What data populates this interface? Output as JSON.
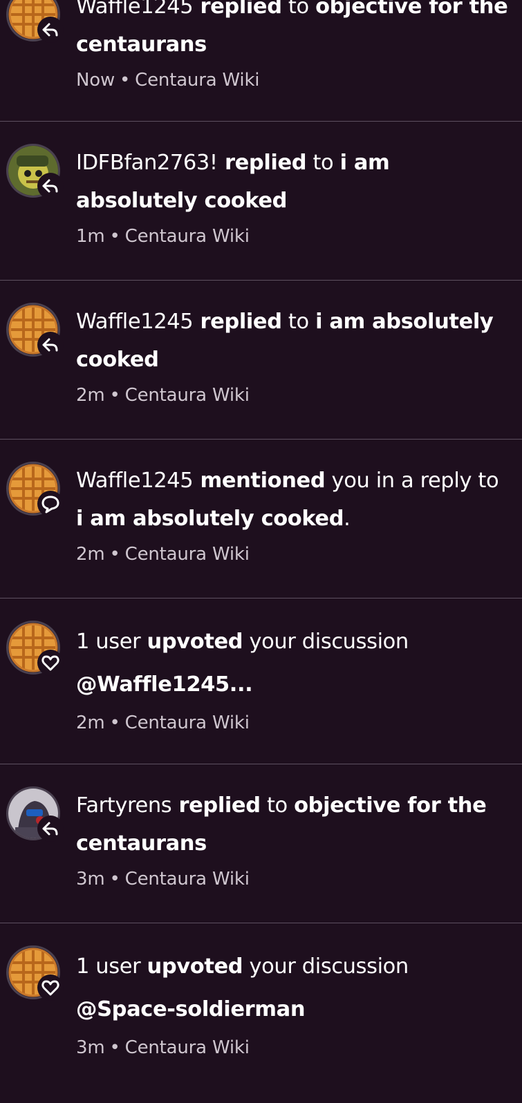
{
  "notifications": [
    {
      "avatar": "waffle-avatar",
      "badge": "reply-icon",
      "parts": [
        {
          "text": "Waffle1245",
          "bold": false
        },
        {
          "text": " replied",
          "bold": true
        },
        {
          "text": " to ",
          "bold": false
        },
        {
          "text": "objective for the centaurans",
          "bold": true
        }
      ],
      "time": "Now",
      "source": "Centaura Wiki"
    },
    {
      "avatar": "idf-avatar",
      "badge": "reply-icon",
      "parts": [
        {
          "text": "IDFBfan2763!",
          "bold": false
        },
        {
          "text": " replied",
          "bold": true
        },
        {
          "text": " to ",
          "bold": false
        },
        {
          "text": "i am absolutely cooked",
          "bold": true
        }
      ],
      "time": "1m",
      "source": "Centaura Wiki"
    },
    {
      "avatar": "waffle-avatar",
      "badge": "reply-icon",
      "parts": [
        {
          "text": "Waffle1245",
          "bold": false
        },
        {
          "text": " replied",
          "bold": true
        },
        {
          "text": " to ",
          "bold": false
        },
        {
          "text": "i am absolutely cooked",
          "bold": true
        }
      ],
      "time": "2m",
      "source": "Centaura Wiki"
    },
    {
      "avatar": "waffle-avatar",
      "badge": "mention-icon",
      "parts": [
        {
          "text": "Waffle1245",
          "bold": false
        },
        {
          "text": " mentioned",
          "bold": true
        },
        {
          "text": " you in a reply to ",
          "bold": false
        },
        {
          "text": "i am absolutely cooked",
          "bold": true
        },
        {
          "text": ".",
          "bold": false
        }
      ],
      "time": "2m",
      "source": "Centaura Wiki"
    },
    {
      "avatar": "waffle-avatar",
      "badge": "heart-icon",
      "parts": [
        {
          "text": "1 user ",
          "bold": false
        },
        {
          "text": "upvoted",
          "bold": true
        },
        {
          "text": " your discussion ",
          "bold": false
        },
        {
          "text": "@Waffle1245...",
          "bold": true
        }
      ],
      "time": "2m",
      "source": "Centaura Wiki"
    },
    {
      "avatar": "fartyrens-avatar",
      "badge": "reply-icon",
      "parts": [
        {
          "text": "Fartyrens",
          "bold": false
        },
        {
          "text": " replied",
          "bold": true
        },
        {
          "text": " to ",
          "bold": false
        },
        {
          "text": "objective for the centaurans",
          "bold": true
        }
      ],
      "time": "3m",
      "source": "Centaura Wiki"
    },
    {
      "avatar": "waffle-avatar",
      "badge": "heart-icon",
      "parts": [
        {
          "text": "1 user ",
          "bold": false
        },
        {
          "text": "upvoted",
          "bold": true
        },
        {
          "text": " your discussion ",
          "bold": false
        },
        {
          "text": "@Space-soldierman",
          "bold": true
        }
      ],
      "time": "3m",
      "source": "Centaura Wiki"
    }
  ],
  "separator": "•"
}
